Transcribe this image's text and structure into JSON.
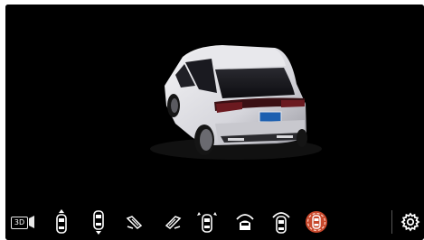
{
  "toolbar": {
    "view_3d_label": "3D",
    "buttons": [
      {
        "name": "front-view-icon",
        "active": false
      },
      {
        "name": "rear-view-icon",
        "active": false
      },
      {
        "name": "left-side-view-icon",
        "active": false
      },
      {
        "name": "right-side-view-icon",
        "active": false
      },
      {
        "name": "front-wheel-view-icon",
        "active": false
      },
      {
        "name": "front-wide-view-icon",
        "active": false
      },
      {
        "name": "rear-wide-view-icon",
        "active": false
      },
      {
        "name": "radar-sensor-icon",
        "active": true
      }
    ],
    "active_color": "#c8482c"
  },
  "viewport": {
    "background": "#000000",
    "car_color": "#e6e6ea",
    "plate_color": "#1c5fb0"
  }
}
